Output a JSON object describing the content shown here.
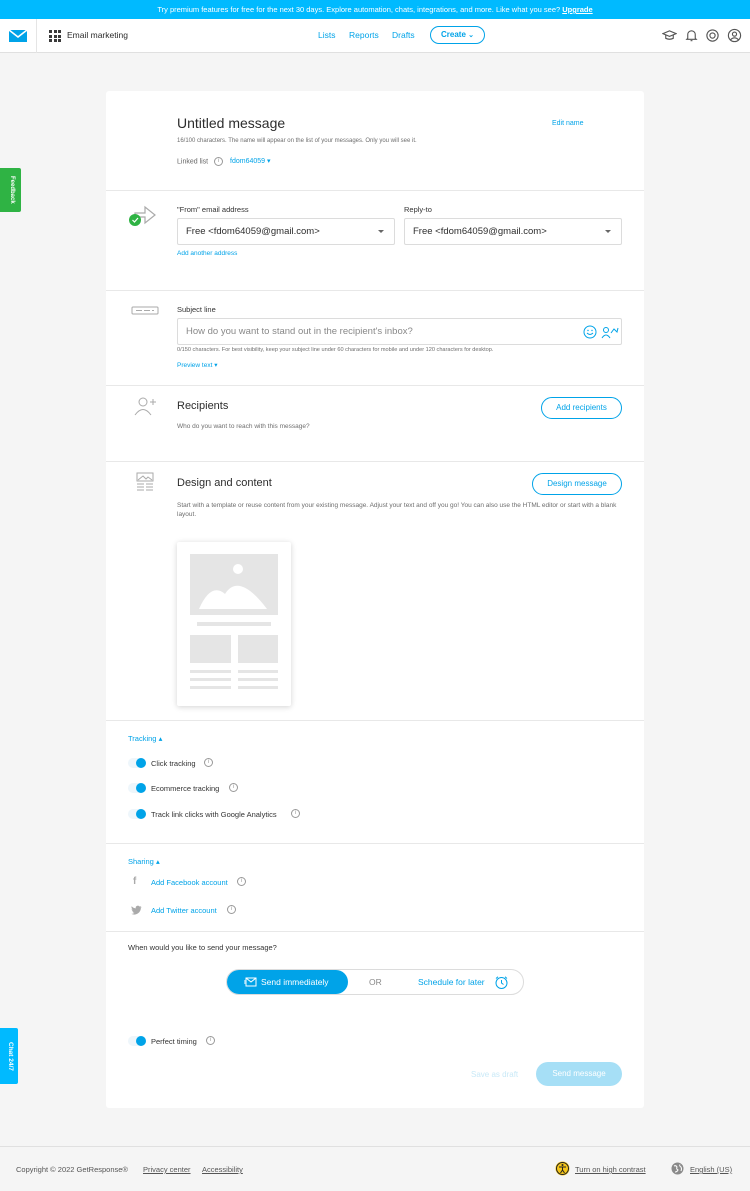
{
  "promo": {
    "text": "Try premium features for free for the next 30 days. Explore automation, chats, integrations, and more. Like what you see?",
    "link": "Upgrade"
  },
  "header": {
    "app_name": "Email marketing",
    "nav": [
      "Lists",
      "Reports",
      "Drafts"
    ],
    "create_label": "Create"
  },
  "side": {
    "feedback": "Feedback",
    "chat": "Chat 24/7"
  },
  "message": {
    "title": "Untitled message",
    "edit_name": "Edit name",
    "name_hint": "16/100 characters. The name will appear on the list of your messages. Only you will see it.",
    "linked_list_label": "Linked list",
    "linked_list_value": "fdom64059"
  },
  "sender": {
    "from_label": "\"From\" email address",
    "from_value": "Free <fdom64059@gmail.com>",
    "reply_label": "Reply-to",
    "reply_value": "Free <fdom64059@gmail.com>",
    "add_address": "Add another address"
  },
  "subject": {
    "label": "Subject line",
    "placeholder": "How do you want to stand out in the recipient's inbox?",
    "hint": "0/150 characters. For best visibility, keep your subject line under 60 characters for mobile and under 120 characters for desktop.",
    "preview_text": "Preview text"
  },
  "recipients": {
    "title": "Recipients",
    "desc": "Who do you want to reach with this message?",
    "button": "Add recipients"
  },
  "design": {
    "title": "Design and content",
    "desc": "Start with a template or reuse content from your existing message. Adjust your text and off you go! You can also use the HTML editor or start with a blank layout.",
    "button": "Design message"
  },
  "tracking": {
    "header": "Tracking",
    "items": [
      "Click tracking",
      "Ecommerce tracking",
      "Track link clicks with Google Analytics"
    ]
  },
  "sharing": {
    "header": "Sharing",
    "facebook": "Add Facebook account",
    "twitter": "Add Twitter account"
  },
  "send": {
    "question": "When would you like to send your message?",
    "immediately": "Send immediately",
    "or": "OR",
    "later": "Schedule for later",
    "perfect_timing": "Perfect timing",
    "save_draft": "Save as draft",
    "send_message": "Send message"
  },
  "footer": {
    "copyright": "Copyright © 2022 GetResponse®",
    "privacy": "Privacy center",
    "accessibility": "Accessibility",
    "contrast": "Turn on high contrast",
    "language": "English (US)"
  },
  "colors": {
    "accent": "#00a3e8",
    "promo": "#00baff",
    "feedback": "#2fb344"
  }
}
